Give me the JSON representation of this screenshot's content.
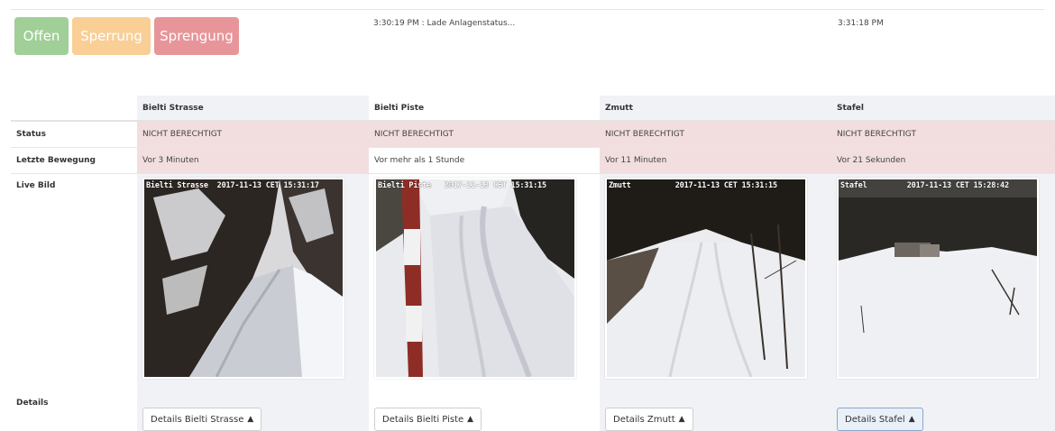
{
  "state_buttons": {
    "offen": "Offen",
    "sperrung": "Sperrung",
    "sprengung": "Sprengung"
  },
  "messages": {
    "left": "3:30:19 PM : Lade Anlagenstatus...",
    "right": "3:31:18 PM"
  },
  "table": {
    "row_labels": {
      "status": "Status",
      "last_move": "Letzte Bewegung",
      "live": "Live Bild",
      "details": "Details"
    },
    "columns": [
      {
        "name": "Bielti Strasse",
        "status": "NICHT BERECHTIGT",
        "last_move": "Vor 3 Minuten",
        "cam_overlay": "Bielti Strasse  2017-11-13 CET 15:31:17",
        "details_label": "Details Bielti Strasse"
      },
      {
        "name": "Bielti Piste",
        "status": "NICHT BERECHTIGT",
        "last_move": "Vor mehr als 1 Stunde",
        "cam_overlay": "Bielti Piste   2017-11-13 CET 15:31:15",
        "details_label": "Details Bielti Piste"
      },
      {
        "name": "Zmutt",
        "status": "NICHT BERECHTIGT",
        "last_move": "Vor 11 Minuten",
        "cam_overlay": "Zmutt          2017-11-13 CET 15:31:15",
        "details_label": "Details Zmutt"
      },
      {
        "name": "Stafel",
        "status": "NICHT BERECHTIGT",
        "last_move": "Vor 21 Sekunden",
        "cam_overlay": "Stafel         2017-11-13 CET 15:28:42",
        "details_label": "Details Stafel"
      }
    ]
  },
  "icons": {
    "details_chevron": "chevron-up-icon"
  },
  "colors": {
    "offen": "#a0cf98",
    "sperrung": "#f9cf96",
    "sprengung": "#e89599",
    "danger_row": "#f2dede",
    "column_stripe": "#f1f2f5"
  }
}
